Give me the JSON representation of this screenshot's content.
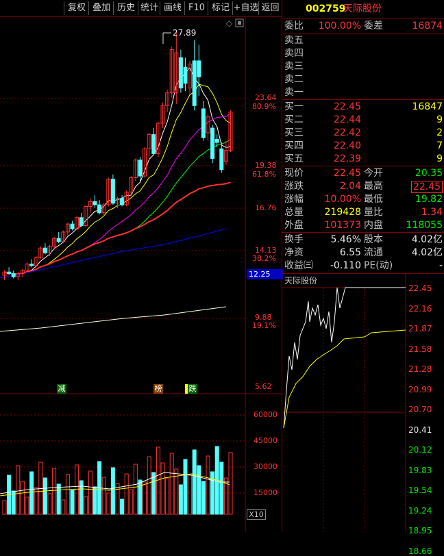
{
  "toolbar": {
    "items": [
      "复权",
      "叠加",
      "历史",
      "统计",
      "画线",
      "F10",
      "标记",
      "+自选",
      "返回"
    ]
  },
  "kline": {
    "high_label": "27.89",
    "price_axis": [
      {
        "v": "23.64",
        "p": "80.9%"
      },
      {
        "v": "19.38",
        "p": "61.8%"
      },
      {
        "v": "16.76",
        "p": ""
      },
      {
        "v": "14.13",
        "p": "38.2%"
      },
      {
        "v": "9.88",
        "p": "19.1%"
      },
      {
        "v": "5.62",
        "p": ""
      }
    ],
    "current_price_tag": "12.25",
    "markers": [
      "减",
      "榜",
      "跌"
    ],
    "volume_axis": [
      "60000",
      "45000",
      "30000",
      "15000"
    ],
    "volume_unit": "X10"
  },
  "quote": {
    "code": "002759",
    "name": "天际股份",
    "weibi_label": "委比",
    "weibi_value": "100.00%",
    "weicha_label": "委差",
    "weicha_value": "16874",
    "sells": [
      {
        "label": "卖五"
      },
      {
        "label": "卖四"
      },
      {
        "label": "卖三"
      },
      {
        "label": "卖二"
      },
      {
        "label": "卖一"
      }
    ],
    "buys": [
      {
        "label": "买一",
        "price": "22.45",
        "vol": "16847"
      },
      {
        "label": "买二",
        "price": "22.44",
        "vol": "9"
      },
      {
        "label": "买三",
        "price": "22.42",
        "vol": "2"
      },
      {
        "label": "买四",
        "price": "22.40",
        "vol": "7"
      },
      {
        "label": "买五",
        "price": "22.39",
        "vol": "9"
      }
    ],
    "stats": [
      {
        "l1": "现价",
        "v1": "22.45",
        "c1": "red",
        "l2": "今开",
        "v2": "20.35",
        "c2": "green"
      },
      {
        "l1": "涨跌",
        "v1": "2.04",
        "c1": "red",
        "l2": "最高",
        "v2": "22.45",
        "c2": "red"
      },
      {
        "l1": "涨幅",
        "v1": "10.00%",
        "c1": "red",
        "l2": "最低",
        "v2": "19.82",
        "c2": "green"
      },
      {
        "l1": "总量",
        "v1": "219428",
        "c1": "yellow",
        "l2": "量比",
        "v2": "1.34",
        "c2": "red"
      },
      {
        "l1": "外盘",
        "v1": "101373",
        "c1": "red",
        "l2": "内盘",
        "v2": "118055",
        "c2": "green"
      }
    ],
    "fin": [
      {
        "l1": "换手",
        "v1": "5.46%",
        "l2": "股本",
        "v2": "4.02亿"
      },
      {
        "l1": "净资",
        "v1": "6.55",
        "l2": "流通",
        "v2": "4.02亿"
      },
      {
        "l1": "收益㈢",
        "v1": "-0.110",
        "l2": "PE(动)",
        "v2": "-"
      }
    ]
  },
  "intraday": {
    "title": "天际股份",
    "axis": [
      {
        "v": "22.45",
        "c": "red"
      },
      {
        "v": "22.16",
        "c": "red"
      },
      {
        "v": "21.87",
        "c": "red"
      },
      {
        "v": "21.58",
        "c": "red"
      },
      {
        "v": "21.28",
        "c": "red"
      },
      {
        "v": "20.99",
        "c": "red"
      },
      {
        "v": "20.70",
        "c": "red"
      },
      {
        "v": "20.41",
        "c": "white"
      },
      {
        "v": "20.12",
        "c": "green"
      },
      {
        "v": "19.83",
        "c": "green"
      },
      {
        "v": "19.54",
        "c": "green"
      },
      {
        "v": "19.24",
        "c": "green"
      },
      {
        "v": "18.95",
        "c": "green"
      },
      {
        "v": "18.66",
        "c": "green"
      }
    ]
  }
}
